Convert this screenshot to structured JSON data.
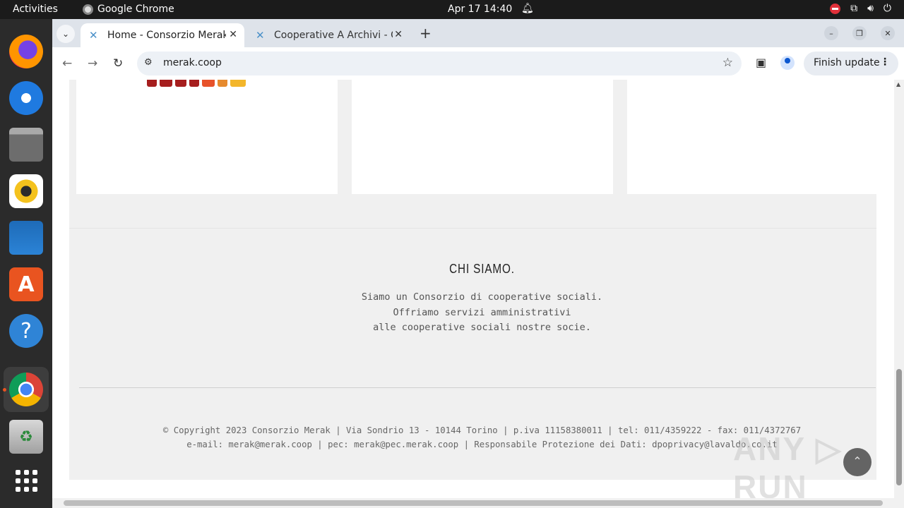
{
  "topbar": {
    "activities": "Activities",
    "app_name": "Google Chrome",
    "datetime": "Apr 17  14:40"
  },
  "dock": {
    "items": [
      "firefox",
      "thunderbird",
      "files",
      "rhythmbox",
      "libreoffice-writer",
      "app-center",
      "help",
      "google-chrome",
      "trash",
      "show-apps"
    ]
  },
  "browser": {
    "tabs": [
      {
        "title": "Home - Consorzio Merak",
        "active": true
      },
      {
        "title": "Cooperative A Archivi - C",
        "active": false
      }
    ],
    "url": "merak.coop",
    "update_label": "Finish update"
  },
  "page": {
    "about_title": "CHI SIAMO.",
    "about_lines": [
      "Siamo un Consorzio di cooperative sociali.",
      "Offriamo servizi amministrativi",
      "alle cooperative sociali nostre socie."
    ],
    "footer_lines": [
      "© Copyright 2023 Consorzio Merak | Via Sondrio 13 - 10144 Torino | p.iva 11158380011 | tel: 011/4359222 - fax: 011/4372767",
      "e-mail: merak@merak.coop | pec: merak@pec.merak.coop | Responsabile Protezione dei Dati: dpoprivacy@lavaldo.co.it"
    ],
    "watermark": "ANY ▷ RUN"
  },
  "colors": {
    "accent": "#e95420",
    "panel_bg": "#f0f0f0",
    "logo_red": "#a61e1e"
  }
}
